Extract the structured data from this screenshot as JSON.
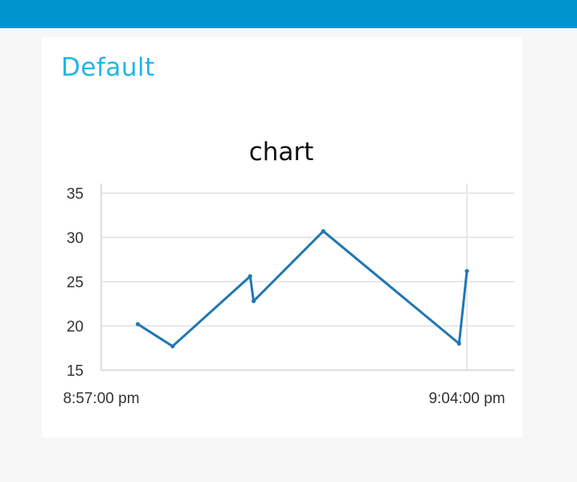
{
  "header": {
    "bar_color": "#0094ce"
  },
  "group": {
    "title": "Default",
    "title_color": "#1fb7ea"
  },
  "chart_data": {
    "type": "line",
    "title": "chart",
    "xlabel": "",
    "ylabel": "",
    "ylim": [
      15,
      35
    ],
    "y_ticks": [
      35,
      30,
      25,
      20,
      15
    ],
    "y_tick_labels": [
      "35",
      "30",
      "25",
      "20",
      "15"
    ],
    "xlim": [
      "8:57:00 pm",
      "9:04:00 pm"
    ],
    "x_tick_labels": [
      "8:57:00 pm",
      "9:04:00 pm"
    ],
    "grid": true,
    "series": [
      {
        "color": "#1f77b4",
        "x": [
          "8:57:42 pm",
          "8:58:22 pm",
          "8:59:51 pm",
          "8:59:55 pm",
          "9:01:15 pm",
          "9:03:51 pm",
          "9:04:00 pm"
        ],
        "y": [
          20.2,
          17.7,
          25.6,
          22.8,
          30.7,
          18.0,
          26.2
        ]
      }
    ]
  }
}
